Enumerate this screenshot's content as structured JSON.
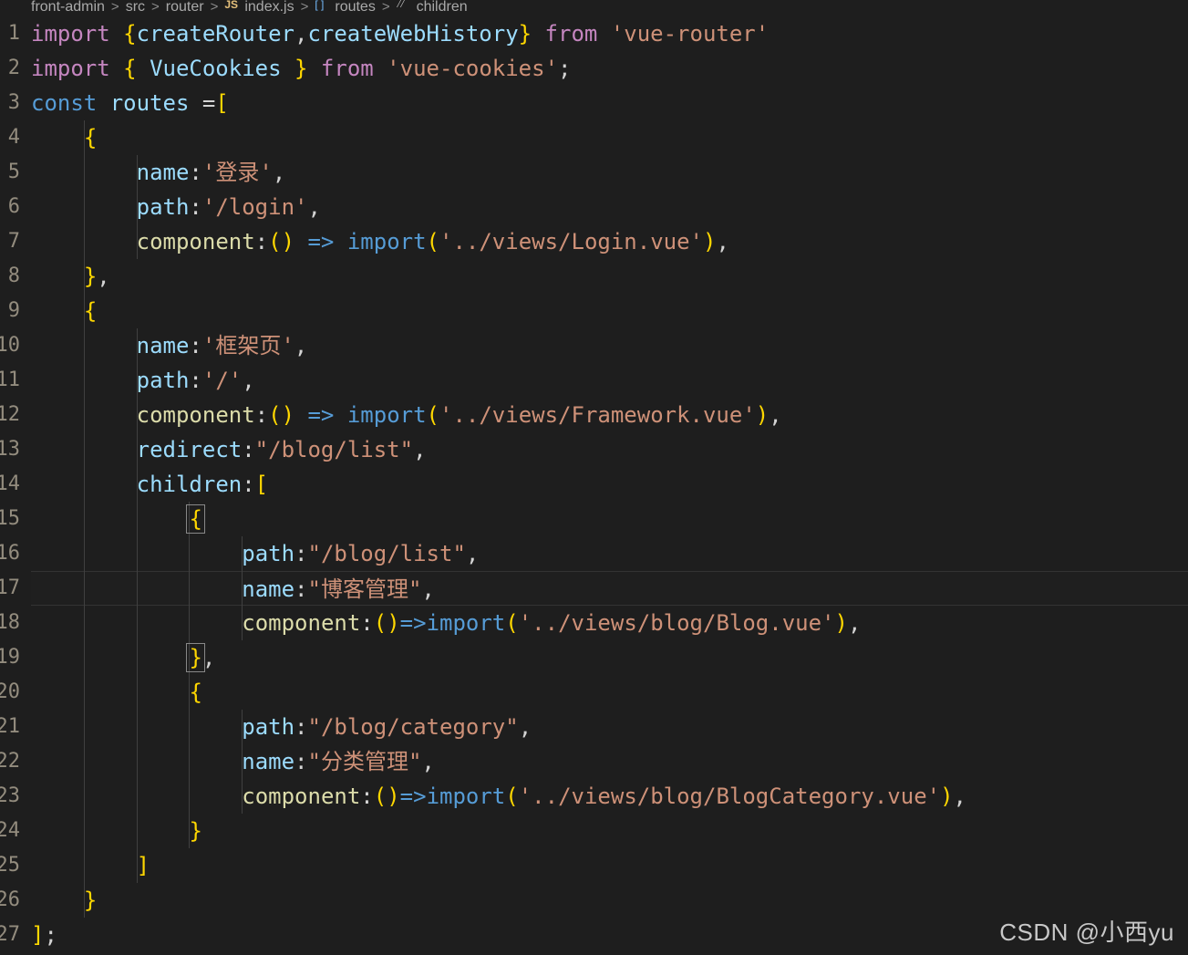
{
  "window": {
    "theme": "dark",
    "background": "#1e1e1e",
    "line_height_px": 38,
    "font_size_px": 24
  },
  "breadcrumb": {
    "name": "front-admin > src > router > index.js > routes > children",
    "items": [
      {
        "label": "front-admin",
        "icon": ""
      },
      {
        "label": "src",
        "icon": ""
      },
      {
        "label": "router",
        "icon": ""
      },
      {
        "label": "index.js",
        "icon": "js-file-icon"
      },
      {
        "label": "routes",
        "icon": "array-symbol-icon"
      },
      {
        "label": "children",
        "icon": "field-symbol-icon"
      }
    ],
    "separator": ">"
  },
  "editor": {
    "language": "javascript",
    "file": "index.js",
    "current_line": 17,
    "line_numbers": [
      1,
      2,
      3,
      4,
      5,
      6,
      7,
      8,
      9,
      10,
      11,
      12,
      13,
      14,
      15,
      16,
      17,
      18,
      19,
      20,
      21,
      22,
      23,
      24,
      25,
      26,
      27
    ],
    "lines": [
      {
        "n": 1,
        "text": "import {createRouter,createWebHistory} from 'vue-router'"
      },
      {
        "n": 2,
        "text": "import { VueCookies } from 'vue-cookies';"
      },
      {
        "n": 3,
        "text": "const routes =["
      },
      {
        "n": 4,
        "text": "    {"
      },
      {
        "n": 5,
        "text": "        name:'登录',"
      },
      {
        "n": 6,
        "text": "        path:'/login',"
      },
      {
        "n": 7,
        "text": "        component:() => import('../views/Login.vue'),"
      },
      {
        "n": 8,
        "text": "    },"
      },
      {
        "n": 9,
        "text": "    {"
      },
      {
        "n": 10,
        "text": "        name:'框架页',"
      },
      {
        "n": 11,
        "text": "        path:'/',"
      },
      {
        "n": 12,
        "text": "        component:() => import('../views/Framework.vue'),"
      },
      {
        "n": 13,
        "text": "        redirect:\"/blog/list\","
      },
      {
        "n": 14,
        "text": "        children:["
      },
      {
        "n": 15,
        "text": "            {"
      },
      {
        "n": 16,
        "text": "                path:\"/blog/list\","
      },
      {
        "n": 17,
        "text": "                name:\"博客管理\","
      },
      {
        "n": 18,
        "text": "                component:()=>import('../views/blog/Blog.vue'),"
      },
      {
        "n": 19,
        "text": "            },"
      },
      {
        "n": 20,
        "text": "            {"
      },
      {
        "n": 21,
        "text": "                path:\"/blog/category\","
      },
      {
        "n": 22,
        "text": "                name:\"分类管理\","
      },
      {
        "n": 23,
        "text": "                component:()=>import('../views/blog/BlogCategory.vue'),"
      },
      {
        "n": 24,
        "text": "            }"
      },
      {
        "n": 25,
        "text": "        ]"
      },
      {
        "n": 26,
        "text": "    }"
      },
      {
        "n": 27,
        "text": "];"
      }
    ],
    "colors": {
      "keyword": "#c586c0",
      "identifier": "#9cdcfe",
      "builtin": "#569cd6",
      "function": "#dcdcaa",
      "string": "#ce9178",
      "plain": "#d4d4d4",
      "line_number": "#938c7e",
      "indent_guide": "#404040",
      "current_line_border": "#333333",
      "bracket_match_border": "#888888"
    }
  },
  "watermark": {
    "text": "CSDN @小西yu"
  }
}
